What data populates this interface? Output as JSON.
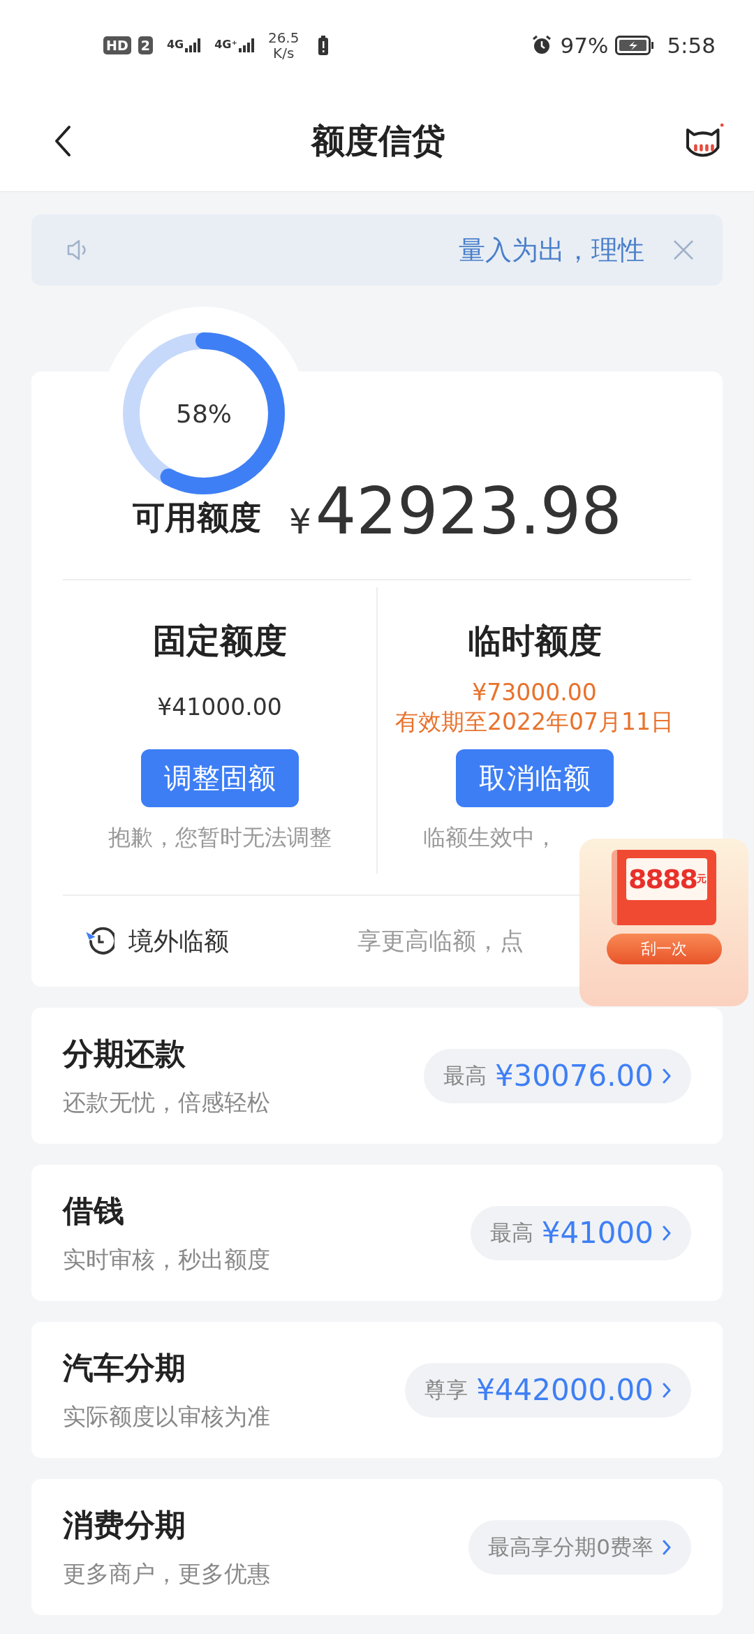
{
  "status_bar": {
    "sim_badges": [
      "HD",
      "2"
    ],
    "networks": [
      "4G",
      "4G⁺"
    ],
    "speed": "26.5",
    "speed_unit": "K/s",
    "battery": "97%",
    "time": "5:58"
  },
  "nav": {
    "title": "额度信贷"
  },
  "notice": {
    "text": "量入为出，理性"
  },
  "credit": {
    "usage": {
      "level": 0.58,
      "label": "58%"
    },
    "label": "可用额度",
    "currency": "¥",
    "amount": "42923.98",
    "columns": [
      {
        "title": "固定额度",
        "lines": [
          "¥41000.00"
        ],
        "highlight": false,
        "button": "调整固额",
        "note": "抱歉，您暂时无法调整"
      },
      {
        "title": "临时额度",
        "lines": [
          "¥73000.00",
          "有效期至2022年07月11日"
        ],
        "highlight": true,
        "button": "取消临额",
        "note": "临额生效中，"
      }
    ],
    "overseas": {
      "label": "境外临额",
      "hint": "享更高临额，点"
    }
  },
  "promo": {
    "amount": "8888",
    "unit": "元",
    "button": "刮一次"
  },
  "products": [
    {
      "title": "分期还款",
      "subtitle": "还款无忧，倍感轻松",
      "prefix": "最高",
      "value": "¥30076.00"
    },
    {
      "title": "借钱",
      "subtitle": "实时审核，秒出额度",
      "prefix": "最高",
      "value": "¥41000"
    },
    {
      "title": "汽车分期",
      "subtitle": "实际额度以审核为准",
      "prefix": "尊享",
      "value": "¥442000.00"
    },
    {
      "title": "消费分期",
      "subtitle": "更多商户，更多优惠",
      "prefix": "最高享分期0费率"
    }
  ]
}
